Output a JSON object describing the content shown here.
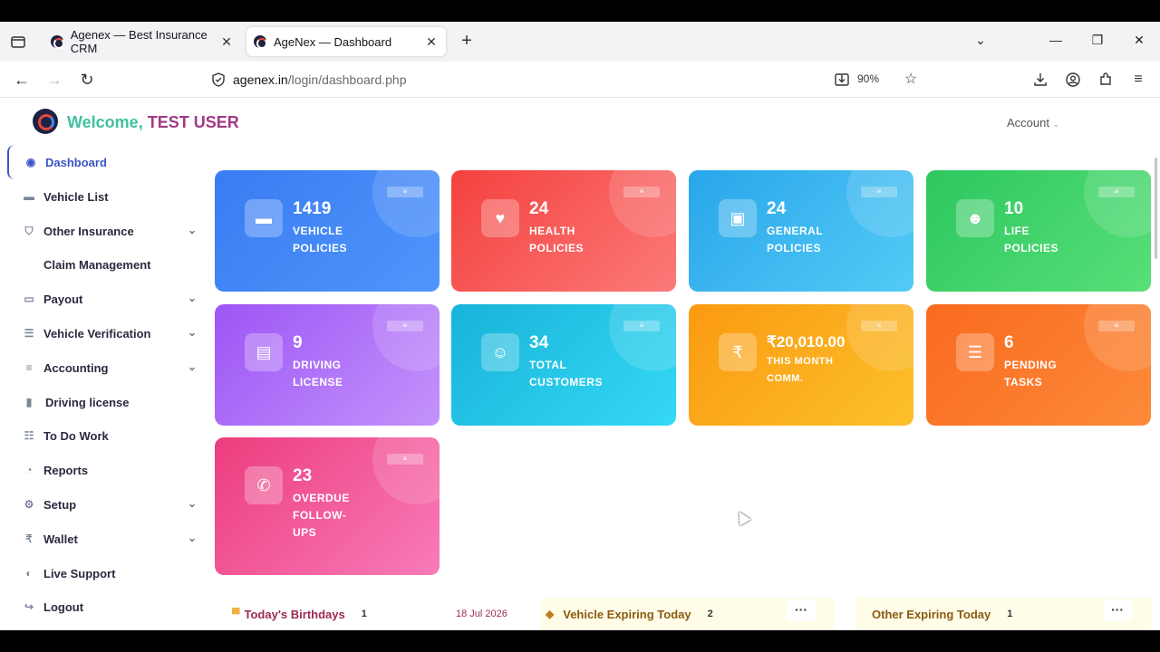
{
  "browser": {
    "tabs": [
      {
        "title": "Agenex — Best Insurance CRM"
      },
      {
        "title": "AgeNex — Dashboard"
      }
    ],
    "url_host": "agenex.in",
    "url_path": "/login/dashboard.php",
    "zoom": "90%"
  },
  "header": {
    "welcome": "Welcome,",
    "user": "TEST USER",
    "account": "Account"
  },
  "sidebar": {
    "items": [
      {
        "label": "Dashboard"
      },
      {
        "label": "Vehicle List"
      },
      {
        "label": "Other Insurance"
      },
      {
        "label": "Claim Management"
      },
      {
        "label": "Payout"
      },
      {
        "label": "Vehicle Verification"
      },
      {
        "label": "Accounting"
      },
      {
        "label": "Driving license"
      },
      {
        "label": "To Do Work"
      },
      {
        "label": "Reports"
      },
      {
        "label": "Setup"
      },
      {
        "label": "Wallet"
      },
      {
        "label": "Live Support"
      },
      {
        "label": "Logout"
      }
    ]
  },
  "cards": [
    {
      "value": "1419",
      "l1": "VEHICLE",
      "l2": "POLICIES",
      "l3": "",
      "color_from": "#3a7bf2",
      "color_to": "#4f96fb",
      "icon": "car-icon"
    },
    {
      "value": "24",
      "l1": "HEALTH",
      "l2": "POLICIES",
      "l3": "",
      "color_from": "#f4413e",
      "color_to": "#fb7a78",
      "icon": "heart-pulse-icon"
    },
    {
      "value": "24",
      "l1": "GENERAL",
      "l2": "POLICIES",
      "l3": "",
      "color_from": "#29a6ea",
      "color_to": "#53cbf6",
      "icon": "briefcase-icon"
    },
    {
      "value": "10",
      "l1": "LIFE",
      "l2": "POLICIES",
      "l3": "",
      "color_from": "#2dc760",
      "color_to": "#58df78",
      "icon": "user-shield-icon"
    },
    {
      "value": "9",
      "l1": "DRIVING",
      "l2": "LICENSE",
      "l3": "",
      "color_from": "#9d55f5",
      "color_to": "#c493fb",
      "icon": "id-card-icon"
    },
    {
      "value": "34",
      "l1": "TOTAL",
      "l2": "CUSTOMERS",
      "l3": "",
      "color_from": "#19b3d9",
      "color_to": "#34d9f5",
      "icon": "users-icon"
    },
    {
      "value": "₹20,010.00",
      "l1": "THIS MONTH",
      "l2": "COMM.",
      "l3": "",
      "color_from": "#fb9a12",
      "color_to": "#fbc02a",
      "icon": "rupee-icon"
    },
    {
      "value": "6",
      "l1": "PENDING",
      "l2": "TASKS",
      "l3": "",
      "color_from": "#fa6a1f",
      "color_to": "#fc8a3a",
      "icon": "tasks-icon"
    },
    {
      "value": "23",
      "l1": "OVERDUE",
      "l2": "FOLLOW-",
      "l3": "UPS",
      "color_from": "#ec3d7d",
      "color_to": "#f97bb9",
      "icon": "phone-slash-icon"
    }
  ],
  "bottom": {
    "birthdays": {
      "title": "Today's Birthdays",
      "count": "1",
      "date": "18 Jul 2026"
    },
    "vehicle_expiring": {
      "title": "Vehicle Expiring Today",
      "count": "2"
    },
    "other_expiring": {
      "title": "Other Expiring Today",
      "count": "1"
    }
  },
  "colors": {
    "accent": "#3b53c8",
    "welcome": "#3fbfa0",
    "user": "#a23a86",
    "birthday": "#9c2a58",
    "expiring": "#8a5a10"
  }
}
